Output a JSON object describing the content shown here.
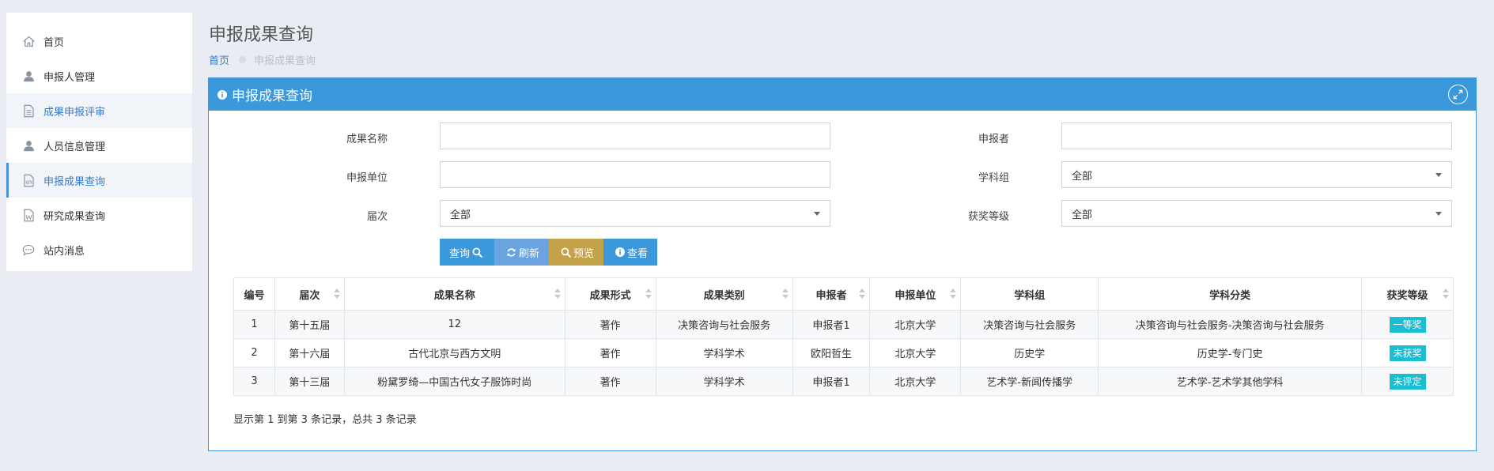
{
  "sidebar": {
    "items": [
      {
        "label": "首页"
      },
      {
        "label": "申报人管理"
      },
      {
        "label": "成果申报评审"
      },
      {
        "label": "人员信息管理"
      },
      {
        "label": "申报成果查询"
      },
      {
        "label": "研究成果查询"
      },
      {
        "label": "站内消息"
      }
    ]
  },
  "header": {
    "title": "申报成果查询",
    "breadcrumb": {
      "home": "首页",
      "current": "申报成果查询"
    }
  },
  "panel": {
    "title": "申报成果查询"
  },
  "form": {
    "name_label": "成果名称",
    "name_value": "",
    "declarer_label": "申报者",
    "declarer_value": "",
    "unit_label": "申报单位",
    "unit_value": "",
    "subject_group_label": "学科组",
    "subject_group_value": "全部",
    "session_label": "届次",
    "session_value": "全部",
    "award_label": "获奖等级",
    "award_value": "全部"
  },
  "buttons": {
    "query": "查询",
    "refresh": "刷新",
    "preview": "预览",
    "view": "查看"
  },
  "table": {
    "columns": [
      "编号",
      "届次",
      "成果名称",
      "成果形式",
      "成果类别",
      "申报者",
      "申报单位",
      "学科组",
      "学科分类",
      "获奖等级"
    ],
    "rows": [
      [
        "1",
        "第十五届",
        "12",
        "著作",
        "决策咨询与社会服务",
        "申报者1",
        "北京大学",
        "决策咨询与社会服务",
        "决策咨询与社会服务-决策咨询与社会服务",
        "一等奖"
      ],
      [
        "2",
        "第十六届",
        "古代北京与西方文明",
        "著作",
        "学科学术",
        "欧阳哲生",
        "北京大学",
        "历史学",
        "历史学-专门史",
        "未获奖"
      ],
      [
        "3",
        "第十三届",
        "粉黛罗绮—中国古代女子服饰时尚",
        "著作",
        "学科学术",
        "申报者1",
        "北京大学",
        "艺术学-新闻传播学",
        "艺术学-艺术学其他学科",
        "未评定"
      ]
    ],
    "summary": "显示第 1 到第 3 条记录，总共 3 条记录"
  },
  "colors": {
    "primary": "#3a98db",
    "badge": "#1bbdd0",
    "preview_button": "#c4a24a",
    "refresh_button": "#6aa3df"
  }
}
